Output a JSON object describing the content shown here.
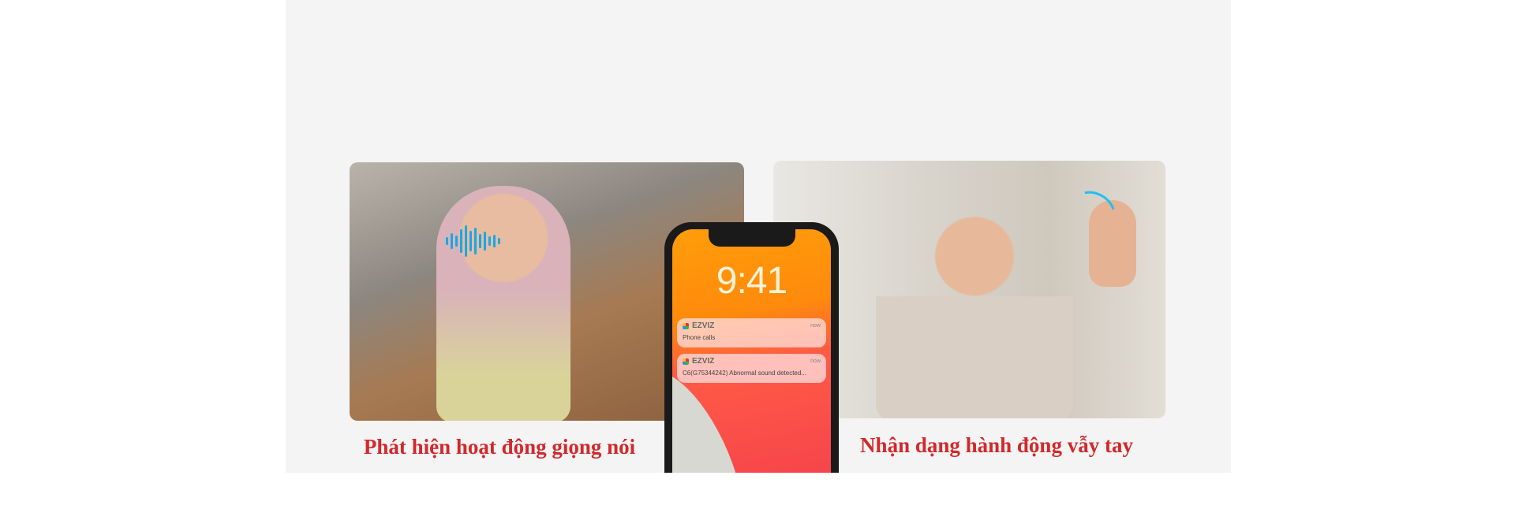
{
  "features": [
    {
      "caption": "Phát hiện hoạt động giọng nói"
    },
    {
      "caption": "Nhận dạng hành động vẫy tay"
    }
  ],
  "phone": {
    "clock": "9:41",
    "notifications": [
      {
        "app": "EZVIZ",
        "time": "now",
        "body": "Phone calls"
      },
      {
        "app": "EZVIZ",
        "time": "now",
        "body": "C6(G75344242) Abnormal sound detected..."
      }
    ]
  },
  "colors": {
    "caption": "#d3282b",
    "panel": "#f4f4f4",
    "accent": "#1aa7e6"
  }
}
